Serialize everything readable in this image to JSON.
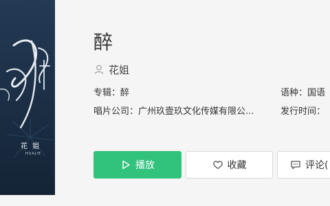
{
  "cover": {
    "title_glyph": "醉",
    "artist": "花 姐",
    "artist_pinyin": "HUAJIE"
  },
  "song": {
    "title": "醉",
    "artist": "花姐"
  },
  "meta": {
    "album_label": "专辑：",
    "album_value": "醉",
    "language_label": "语种：",
    "language_value": "国语",
    "company_label": "唱片公司：",
    "company_value": "广州玖壹玖文化传媒有限公...",
    "release_label": "发行时间："
  },
  "actions": {
    "play_label": "播放",
    "favorite_label": "收藏",
    "comment_label": "评论("
  },
  "colors": {
    "accent": "#31c27c",
    "cover_bg": "#1c3047"
  }
}
